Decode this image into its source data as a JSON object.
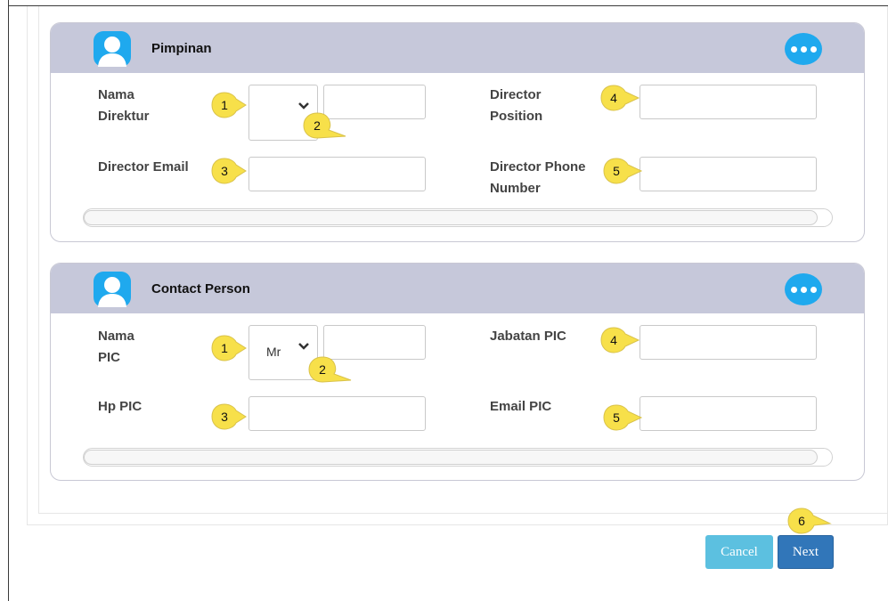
{
  "sections": [
    {
      "title": "Pimpinan",
      "field1_label": "Nama\nDirektur",
      "field1_title_value": "",
      "field3_label": "Director Email",
      "field4_label": "Director\nPosition",
      "field5_label": "Director Phone\nNumber"
    },
    {
      "title": "Contact Person",
      "field1_label": "Nama\nPIC",
      "field1_title_value": "Mr",
      "field3_label": "Hp PIC",
      "field4_label": "Jabatan PIC",
      "field5_label": "Email PIC"
    }
  ],
  "callouts": {
    "n1": "1",
    "n2": "2",
    "n3": "3",
    "n4": "4",
    "n5": "5",
    "n6": "6"
  },
  "buttons": {
    "cancel": "Cancel",
    "next": "Next"
  },
  "colors": {
    "header_bg": "#c6c8da",
    "accent_blue": "#1fa9ee",
    "callout_yellow": "#f7e04a",
    "cancel_bg": "#5cc0e0",
    "next_bg": "#3176b9"
  },
  "icons": {
    "avatar": "user-avatar-icon",
    "more": "more-options-icon",
    "chevron": "chevron-down-icon"
  }
}
